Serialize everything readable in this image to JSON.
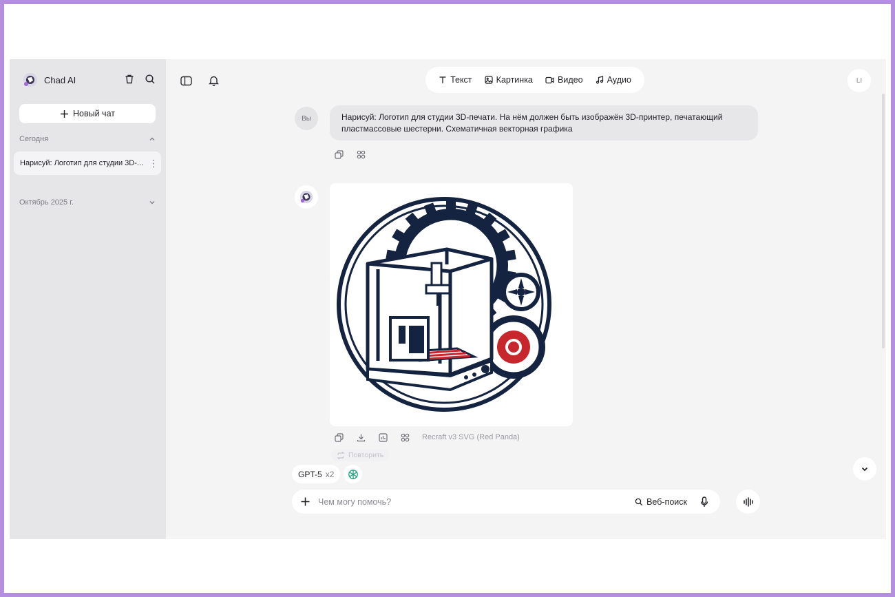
{
  "sidebar": {
    "brand_name": "Chad AI",
    "new_chat_label": "Новый чат",
    "sections": [
      {
        "title": "Сегодня",
        "expanded": true
      },
      {
        "title": "Октябрь 2025 г.",
        "expanded": false
      }
    ],
    "chats": [
      {
        "label": "Нарисуй: Логотип для студии 3D-..."
      }
    ]
  },
  "modes": [
    {
      "label": "Текст",
      "icon": "text-icon"
    },
    {
      "label": "Картинка",
      "icon": "image-icon"
    },
    {
      "label": "Видео",
      "icon": "video-icon"
    },
    {
      "label": "Аудио",
      "icon": "music-icon"
    }
  ],
  "user": {
    "initials": "LI"
  },
  "messages": {
    "user": {
      "avatar": "Вы",
      "text": "Нарисуй: Логотип для студии 3D-печати. На нём должен быть изображён 3D-принтер, печатающий пластмассовые шестерни. Схематичная векторная графика"
    },
    "bot": {
      "model_label": "Recraft v3 SVG (Red Panda)",
      "retry_label": "Повторить"
    }
  },
  "composer": {
    "model": "GPT-5",
    "multiplier": "x2",
    "placeholder": "Чем могу помочь?",
    "web_search_label": "Веб-поиск"
  },
  "colors": {
    "navy": "#14233f",
    "red": "#c7262c",
    "sidebar_bg": "#e6e6e9",
    "main_bg": "#f4f4f5",
    "frame_border": "#b48fe0"
  }
}
